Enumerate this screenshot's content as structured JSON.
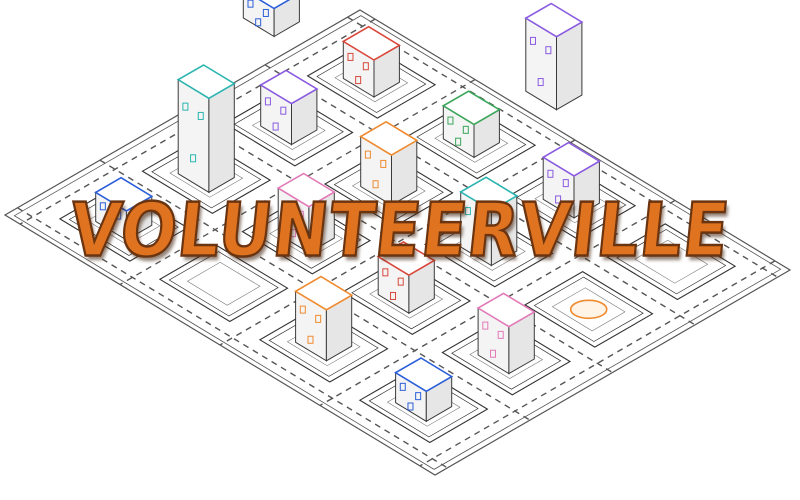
{
  "title": {
    "text": "VOLUNTEERVILLE"
  },
  "palette": {
    "title_fill": "#e0731f",
    "title_outline": "#6b3410",
    "road_line": "#555555",
    "lot_line": "#333333",
    "building_outline": "#3a3a3a",
    "accent_blue": "#2b5fd9",
    "accent_purple": "#8a5be0",
    "accent_teal": "#2bb5b0",
    "accent_red": "#d9483b",
    "accent_orange": "#f08a2e",
    "accent_green": "#3aa65a",
    "accent_pink": "#e27ab8"
  },
  "map": {
    "grid_size": 4,
    "buildings": [
      {
        "name": "stadium-building",
        "row": -1,
        "col": 0
      },
      {
        "name": "warehouse-building",
        "row": 0,
        "col": 1
      },
      {
        "name": "office-tower-building",
        "row": 0,
        "col": 2
      },
      {
        "name": "townhouse-building",
        "row": 0,
        "col": 0
      },
      {
        "name": "apartment-building",
        "row": 1,
        "col": 1
      },
      {
        "name": "house-building",
        "row": 1,
        "col": 0
      },
      {
        "name": "garage-building",
        "row": 1,
        "col": 2
      },
      {
        "name": "depot-building",
        "row": 0,
        "col": 3
      },
      {
        "name": "courthouse-building",
        "row": 2,
        "col": 0
      },
      {
        "name": "shop-building",
        "row": 2,
        "col": 1
      },
      {
        "name": "storefront-building",
        "row": 2,
        "col": 2
      },
      {
        "name": "small-shop-building",
        "row": 2,
        "col": 3
      },
      {
        "name": "park-lot",
        "row": 3,
        "col": 1
      },
      {
        "name": "garden-building",
        "row": 3,
        "col": 2
      },
      {
        "name": "hospital-building",
        "row": 3,
        "col": 3
      },
      {
        "name": "clocktower-building",
        "row": 1,
        "col": -1
      }
    ]
  }
}
